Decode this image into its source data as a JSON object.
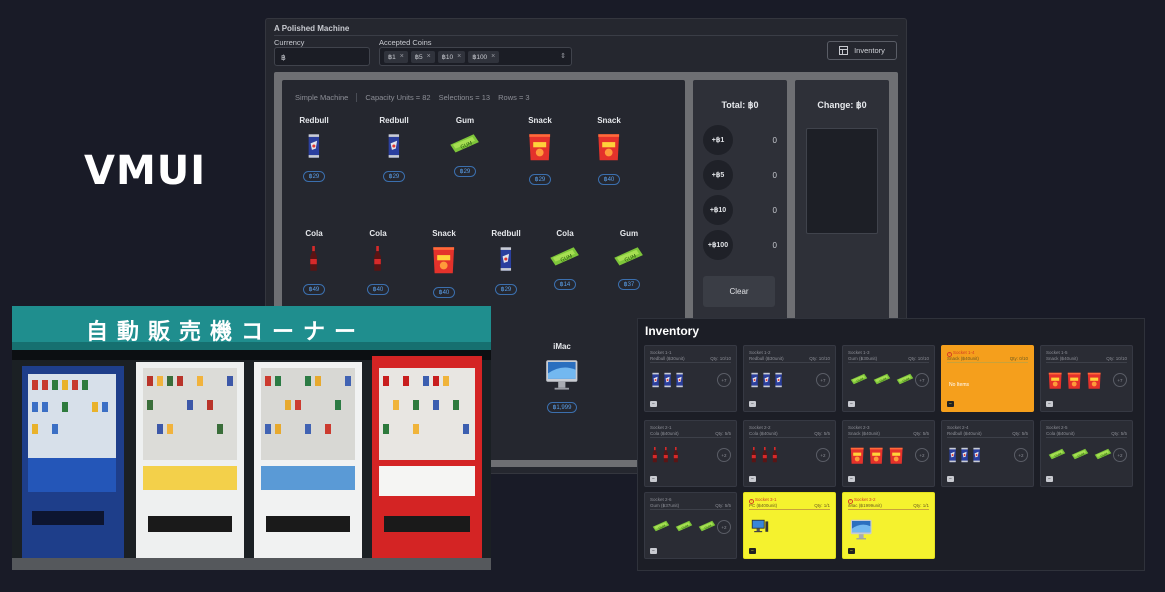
{
  "brand": "VMUI",
  "app": {
    "title": "A Polished Machine",
    "currency_label": "Currency",
    "currency_value": "฿",
    "coins_label": "Accepted Coins",
    "coins": [
      "฿1",
      "฿5",
      "฿10",
      "฿100"
    ],
    "inventory_button": "Inventory"
  },
  "machine": {
    "name": "Simple Machine",
    "capacity": "Capacity Units = 82",
    "selections": "Selections = 13",
    "rows": "Rows = 3",
    "products": [
      {
        "name": "Redbull",
        "price": "฿29",
        "icon": "redbull-can"
      },
      {
        "name": "Redbull",
        "price": "฿29",
        "icon": "redbull-can"
      },
      {
        "name": "Gum",
        "price": "฿29",
        "icon": "gum-pack"
      },
      {
        "name": "Snack",
        "price": "฿29",
        "icon": "snack-bag"
      },
      {
        "name": "Snack",
        "price": "฿40",
        "icon": "snack-bag"
      },
      {
        "name": "Cola",
        "price": "฿49",
        "icon": "cola-bottle"
      },
      {
        "name": "Cola",
        "price": "฿40",
        "icon": "cola-bottle"
      },
      {
        "name": "Snack",
        "price": "฿40",
        "icon": "snack-bag"
      },
      {
        "name": "Redbull",
        "price": "฿29",
        "icon": "redbull-can"
      },
      {
        "name": "Cola",
        "price": "฿14",
        "icon": "gum-pack"
      },
      {
        "name": "Gum",
        "price": "฿37",
        "icon": "gum-pack"
      },
      {
        "name": "iMac",
        "price": "฿1,999",
        "icon": "imac"
      }
    ]
  },
  "total": {
    "title": "Total: ฿0",
    "coins": [
      {
        "label": "+฿1",
        "count": "0"
      },
      {
        "label": "+฿5",
        "count": "0"
      },
      {
        "label": "+฿10",
        "count": "0"
      },
      {
        "label": "+฿100",
        "count": "0"
      }
    ],
    "clear": "Clear"
  },
  "change": {
    "title": "Change: ฿0"
  },
  "photo": {
    "sign": "自動販売機コーナー"
  },
  "inventory": {
    "title": "Inventory",
    "sockets": [
      {
        "id": "Socket 1-1",
        "sub": "Redbull (฿30unit)",
        "qty": "Qty: 10/10",
        "icon": "redbull-can",
        "more": "+7",
        "state": "normal"
      },
      {
        "id": "Socket 1-2",
        "sub": "Redbull (฿30unit)",
        "qty": "Qty: 10/10",
        "icon": "redbull-can",
        "more": "+7",
        "state": "normal"
      },
      {
        "id": "Socket 1-3",
        "sub": "Gum (฿30unit)",
        "qty": "Qty: 10/10",
        "icon": "gum-pack",
        "more": "+7",
        "state": "normal"
      },
      {
        "id": "Socket 1-4",
        "sub": "Snack (฿40unit)",
        "qty": "Qty: 0/10",
        "icon": "",
        "more": "",
        "state": "warn",
        "empty": "No Items"
      },
      {
        "id": "Socket 1-5",
        "sub": "Snack (฿40unit)",
        "qty": "Qty: 10/10",
        "icon": "snack-bag",
        "more": "+7",
        "state": "normal"
      },
      {
        "id": "Socket 2-1",
        "sub": "Cola (฿40unit)",
        "qty": "Qty: 5/5",
        "icon": "cola-bottle",
        "more": "+2",
        "state": "normal"
      },
      {
        "id": "Socket 2-2",
        "sub": "Cola (฿40unit)",
        "qty": "Qty: 5/5",
        "icon": "cola-bottle",
        "more": "+2",
        "state": "normal"
      },
      {
        "id": "Socket 2-3",
        "sub": "Snack (฿40unit)",
        "qty": "Qty: 5/5",
        "icon": "snack-bag",
        "more": "+2",
        "state": "normal"
      },
      {
        "id": "Socket 2-4",
        "sub": "Redbull (฿40unit)",
        "qty": "Qty: 5/5",
        "icon": "redbull-can",
        "more": "+2",
        "state": "normal"
      },
      {
        "id": "Socket 2-5",
        "sub": "Cola (฿40unit)",
        "qty": "Qty: 5/5",
        "icon": "gum-pack",
        "more": "+2",
        "state": "normal"
      },
      {
        "id": "Socket 2-6",
        "sub": "Gum (฿37unit)",
        "qty": "Qty: 5/5",
        "icon": "gum-pack",
        "more": "+2",
        "state": "normal"
      },
      {
        "id": "Socket 3-1",
        "sub": "PC (฿400unit)",
        "qty": "Qty: 1/1",
        "icon": "pc",
        "more": "",
        "state": "yel"
      },
      {
        "id": "Socket 3-2",
        "sub": "iMac (฿1999unit)",
        "qty": "Qty: 1/1",
        "icon": "imac",
        "more": "",
        "state": "yel"
      }
    ]
  }
}
